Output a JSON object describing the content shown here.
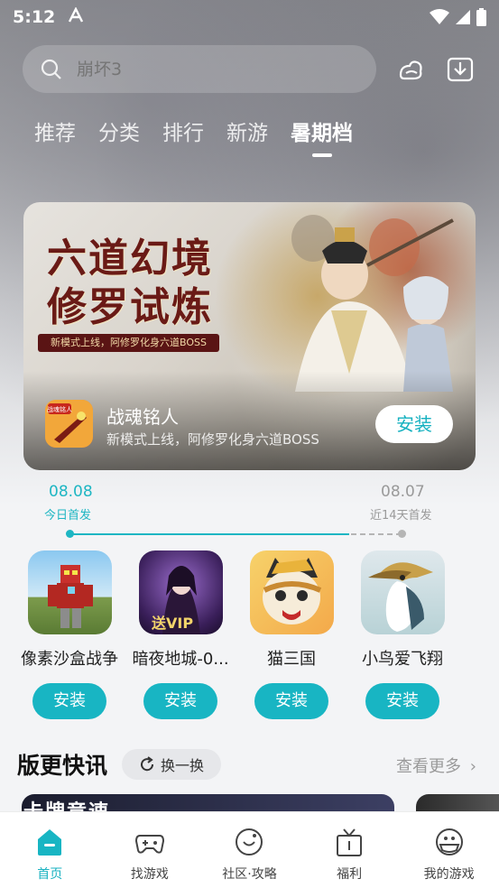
{
  "status_bar": {
    "time": "5:12"
  },
  "search": {
    "placeholder": "崩坏3"
  },
  "tabs": [
    {
      "label": "推荐",
      "active": false
    },
    {
      "label": "分类",
      "active": false
    },
    {
      "label": "排行",
      "active": false
    },
    {
      "label": "新游",
      "active": false
    },
    {
      "label": "暑期档",
      "active": true
    }
  ],
  "banner": {
    "title_line1": "六道幻境",
    "title_line2": "修罗试炼",
    "ribbon": "新模式上线，阿修罗化身六道BOSS",
    "app_icon_badge": "战魂铭人",
    "app_name": "战魂铭人",
    "app_desc": "新模式上线，阿修罗化身六道BOSS",
    "install_label": "安装"
  },
  "timeline": {
    "left_date": "08.08",
    "left_caption": "今日首发",
    "right_date": "08.07",
    "right_caption": "近14天首发",
    "accent": "#1eb6c3"
  },
  "games": [
    {
      "name": "像素沙盒战争",
      "install_label": "安装"
    },
    {
      "name": "暗夜地城-0...",
      "install_label": "安装",
      "icon_text": "送VIP"
    },
    {
      "name": "猫三国",
      "install_label": "安装"
    },
    {
      "name": "小鸟爱飞翔",
      "install_label": "安装"
    }
  ],
  "news": {
    "title": "版更快讯",
    "refresh_label": "换一换",
    "more_label": "查看更多",
    "card1_text": "卡牌竞速"
  },
  "bottom_nav": [
    {
      "label": "首页",
      "icon": "home-icon",
      "active": true
    },
    {
      "label": "找游戏",
      "icon": "gamepad-icon",
      "active": false
    },
    {
      "label": "社区·攻略",
      "icon": "community-icon",
      "active": false
    },
    {
      "label": "福利",
      "icon": "gift-icon",
      "active": false
    },
    {
      "label": "我的游戏",
      "icon": "my-games-icon",
      "active": false
    }
  ]
}
